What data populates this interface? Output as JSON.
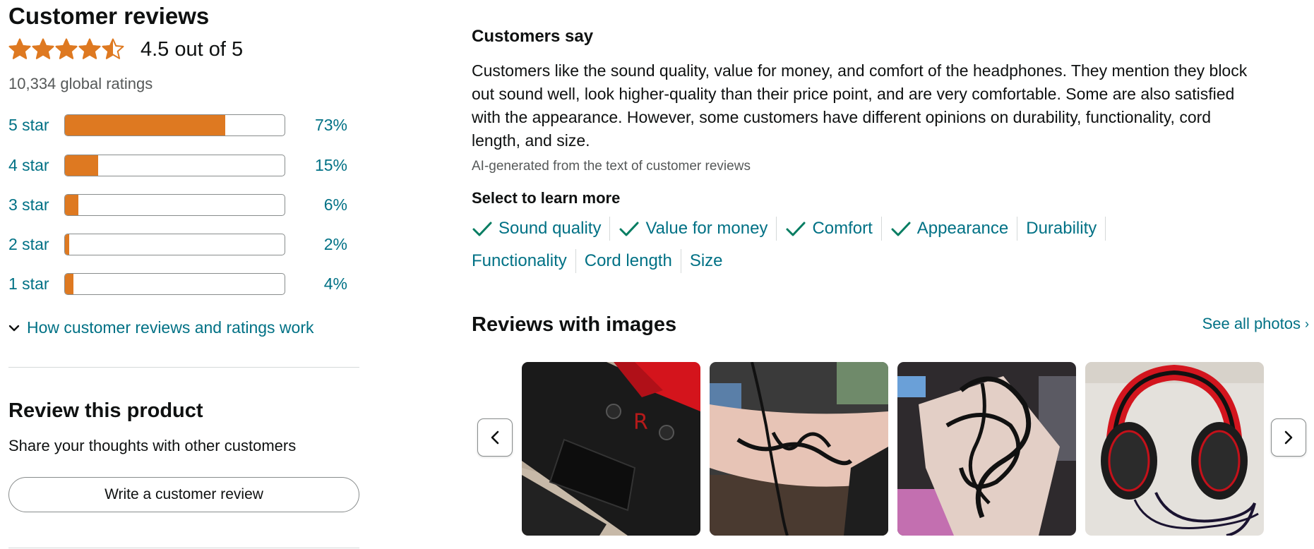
{
  "reviews": {
    "title": "Customer reviews",
    "average_rating": 4.5,
    "rating_text": "4.5 out of 5",
    "global_ratings": "10,334 global ratings",
    "histogram": [
      {
        "label": "5 star",
        "percent": 73,
        "percent_text": "73%"
      },
      {
        "label": "4 star",
        "percent": 15,
        "percent_text": "15%"
      },
      {
        "label": "3 star",
        "percent": 6,
        "percent_text": "6%"
      },
      {
        "label": "2 star",
        "percent": 2,
        "percent_text": "2%"
      },
      {
        "label": "1 star",
        "percent": 4,
        "percent_text": "4%"
      }
    ],
    "how_it_works": "How customer reviews and ratings work"
  },
  "review_product": {
    "title": "Review this product",
    "subtitle": "Share your thoughts with other customers",
    "button_label": "Write a customer review"
  },
  "customers_say": {
    "title": "Customers say",
    "summary": "Customers like the sound quality, value for money, and comfort of the headphones. They mention they block out sound well, look higher-quality than their price point, and are very comfortable. Some are also satisfied with the appearance. However, some customers have different opinions on durability, functionality, cord length, and size.",
    "ai_note": "AI-generated from the text of customer reviews",
    "select_title": "Select to learn more",
    "aspects": [
      {
        "label": "Sound quality",
        "positive": true
      },
      {
        "label": "Value for money",
        "positive": true
      },
      {
        "label": "Comfort",
        "positive": true
      },
      {
        "label": "Appearance",
        "positive": true
      },
      {
        "label": "Durability",
        "positive": false
      },
      {
        "label": "Functionality",
        "positive": false
      },
      {
        "label": "Cord length",
        "positive": false
      },
      {
        "label": "Size",
        "positive": false
      }
    ]
  },
  "reviews_with_images": {
    "title": "Reviews with images",
    "see_all": "See all photos",
    "images": [
      {
        "name": "broken-earcup-photo"
      },
      {
        "name": "tangled-cord-arm-photo"
      },
      {
        "name": "tangled-cord-hand-photo"
      },
      {
        "name": "headphones-photo"
      }
    ]
  },
  "colors": {
    "link": "#007185",
    "star": "#de7921",
    "check": "#067d62",
    "text": "#0f1111",
    "muted": "#565959"
  }
}
